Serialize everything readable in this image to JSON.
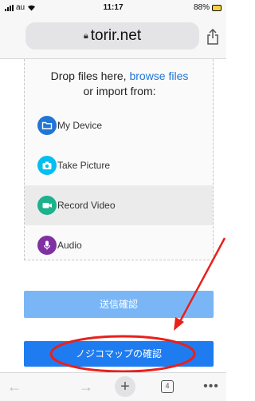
{
  "status_bar": {
    "carrier": "au",
    "time": "11:17",
    "battery": "88%"
  },
  "browser": {
    "url": "torir.net"
  },
  "uploader": {
    "drop_text_prefix": "Drop files here, ",
    "browse_link": "browse files",
    "import_text": "or import from:",
    "sources": [
      {
        "label": "My Device",
        "icon": "folder-icon",
        "color": "#2275d7"
      },
      {
        "label": "Take Picture",
        "icon": "camera-icon",
        "color": "#03bfef"
      },
      {
        "label": "Record Video",
        "icon": "video-camera-icon",
        "color": "#1bb28c"
      },
      {
        "label": "Audio",
        "icon": "microphone-icon",
        "color": "#8030a3"
      }
    ]
  },
  "buttons": {
    "confirm_send": "送信確認",
    "map_confirm": "ノジコマップの確認"
  },
  "toolbar": {
    "tab_count": "4",
    "new_tab_glyph": "+",
    "more_glyph": "•••",
    "back_glyph": "←",
    "forward_glyph": "→"
  },
  "colors": {
    "primary_button": "#1e7cf0",
    "secondary_button": "#7ab6f5",
    "annotation": "#e8201c"
  }
}
